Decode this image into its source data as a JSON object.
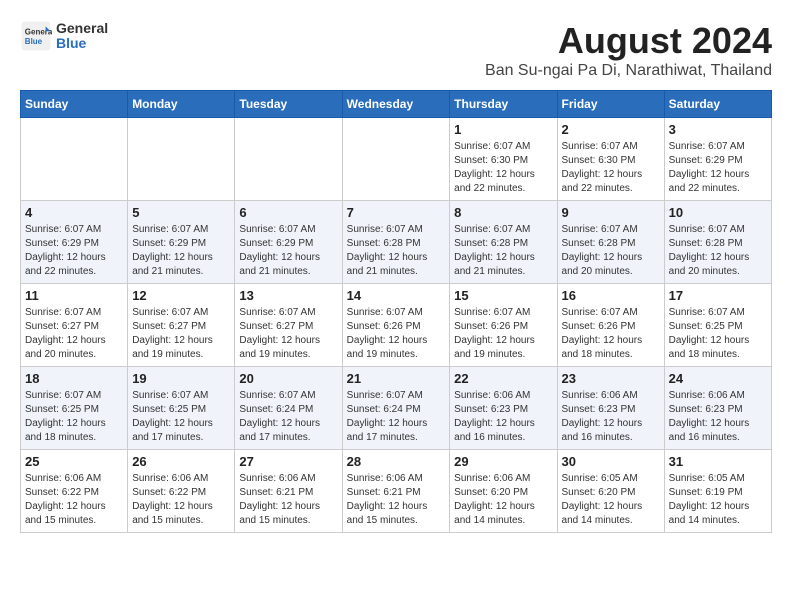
{
  "header": {
    "logo_general": "General",
    "logo_blue": "Blue",
    "month_title": "August 2024",
    "location": "Ban Su-ngai Pa Di, Narathiwat, Thailand"
  },
  "days_of_week": [
    "Sunday",
    "Monday",
    "Tuesday",
    "Wednesday",
    "Thursday",
    "Friday",
    "Saturday"
  ],
  "weeks": [
    [
      {
        "day": "",
        "info": ""
      },
      {
        "day": "",
        "info": ""
      },
      {
        "day": "",
        "info": ""
      },
      {
        "day": "",
        "info": ""
      },
      {
        "day": "1",
        "info": "Sunrise: 6:07 AM\nSunset: 6:30 PM\nDaylight: 12 hours\nand 22 minutes."
      },
      {
        "day": "2",
        "info": "Sunrise: 6:07 AM\nSunset: 6:30 PM\nDaylight: 12 hours\nand 22 minutes."
      },
      {
        "day": "3",
        "info": "Sunrise: 6:07 AM\nSunset: 6:29 PM\nDaylight: 12 hours\nand 22 minutes."
      }
    ],
    [
      {
        "day": "4",
        "info": "Sunrise: 6:07 AM\nSunset: 6:29 PM\nDaylight: 12 hours\nand 22 minutes."
      },
      {
        "day": "5",
        "info": "Sunrise: 6:07 AM\nSunset: 6:29 PM\nDaylight: 12 hours\nand 21 minutes."
      },
      {
        "day": "6",
        "info": "Sunrise: 6:07 AM\nSunset: 6:29 PM\nDaylight: 12 hours\nand 21 minutes."
      },
      {
        "day": "7",
        "info": "Sunrise: 6:07 AM\nSunset: 6:28 PM\nDaylight: 12 hours\nand 21 minutes."
      },
      {
        "day": "8",
        "info": "Sunrise: 6:07 AM\nSunset: 6:28 PM\nDaylight: 12 hours\nand 21 minutes."
      },
      {
        "day": "9",
        "info": "Sunrise: 6:07 AM\nSunset: 6:28 PM\nDaylight: 12 hours\nand 20 minutes."
      },
      {
        "day": "10",
        "info": "Sunrise: 6:07 AM\nSunset: 6:28 PM\nDaylight: 12 hours\nand 20 minutes."
      }
    ],
    [
      {
        "day": "11",
        "info": "Sunrise: 6:07 AM\nSunset: 6:27 PM\nDaylight: 12 hours\nand 20 minutes."
      },
      {
        "day": "12",
        "info": "Sunrise: 6:07 AM\nSunset: 6:27 PM\nDaylight: 12 hours\nand 19 minutes."
      },
      {
        "day": "13",
        "info": "Sunrise: 6:07 AM\nSunset: 6:27 PM\nDaylight: 12 hours\nand 19 minutes."
      },
      {
        "day": "14",
        "info": "Sunrise: 6:07 AM\nSunset: 6:26 PM\nDaylight: 12 hours\nand 19 minutes."
      },
      {
        "day": "15",
        "info": "Sunrise: 6:07 AM\nSunset: 6:26 PM\nDaylight: 12 hours\nand 19 minutes."
      },
      {
        "day": "16",
        "info": "Sunrise: 6:07 AM\nSunset: 6:26 PM\nDaylight: 12 hours\nand 18 minutes."
      },
      {
        "day": "17",
        "info": "Sunrise: 6:07 AM\nSunset: 6:25 PM\nDaylight: 12 hours\nand 18 minutes."
      }
    ],
    [
      {
        "day": "18",
        "info": "Sunrise: 6:07 AM\nSunset: 6:25 PM\nDaylight: 12 hours\nand 18 minutes."
      },
      {
        "day": "19",
        "info": "Sunrise: 6:07 AM\nSunset: 6:25 PM\nDaylight: 12 hours\nand 17 minutes."
      },
      {
        "day": "20",
        "info": "Sunrise: 6:07 AM\nSunset: 6:24 PM\nDaylight: 12 hours\nand 17 minutes."
      },
      {
        "day": "21",
        "info": "Sunrise: 6:07 AM\nSunset: 6:24 PM\nDaylight: 12 hours\nand 17 minutes."
      },
      {
        "day": "22",
        "info": "Sunrise: 6:06 AM\nSunset: 6:23 PM\nDaylight: 12 hours\nand 16 minutes."
      },
      {
        "day": "23",
        "info": "Sunrise: 6:06 AM\nSunset: 6:23 PM\nDaylight: 12 hours\nand 16 minutes."
      },
      {
        "day": "24",
        "info": "Sunrise: 6:06 AM\nSunset: 6:23 PM\nDaylight: 12 hours\nand 16 minutes."
      }
    ],
    [
      {
        "day": "25",
        "info": "Sunrise: 6:06 AM\nSunset: 6:22 PM\nDaylight: 12 hours\nand 15 minutes."
      },
      {
        "day": "26",
        "info": "Sunrise: 6:06 AM\nSunset: 6:22 PM\nDaylight: 12 hours\nand 15 minutes."
      },
      {
        "day": "27",
        "info": "Sunrise: 6:06 AM\nSunset: 6:21 PM\nDaylight: 12 hours\nand 15 minutes."
      },
      {
        "day": "28",
        "info": "Sunrise: 6:06 AM\nSunset: 6:21 PM\nDaylight: 12 hours\nand 15 minutes."
      },
      {
        "day": "29",
        "info": "Sunrise: 6:06 AM\nSunset: 6:20 PM\nDaylight: 12 hours\nand 14 minutes."
      },
      {
        "day": "30",
        "info": "Sunrise: 6:05 AM\nSunset: 6:20 PM\nDaylight: 12 hours\nand 14 minutes."
      },
      {
        "day": "31",
        "info": "Sunrise: 6:05 AM\nSunset: 6:19 PM\nDaylight: 12 hours\nand 14 minutes."
      }
    ]
  ]
}
